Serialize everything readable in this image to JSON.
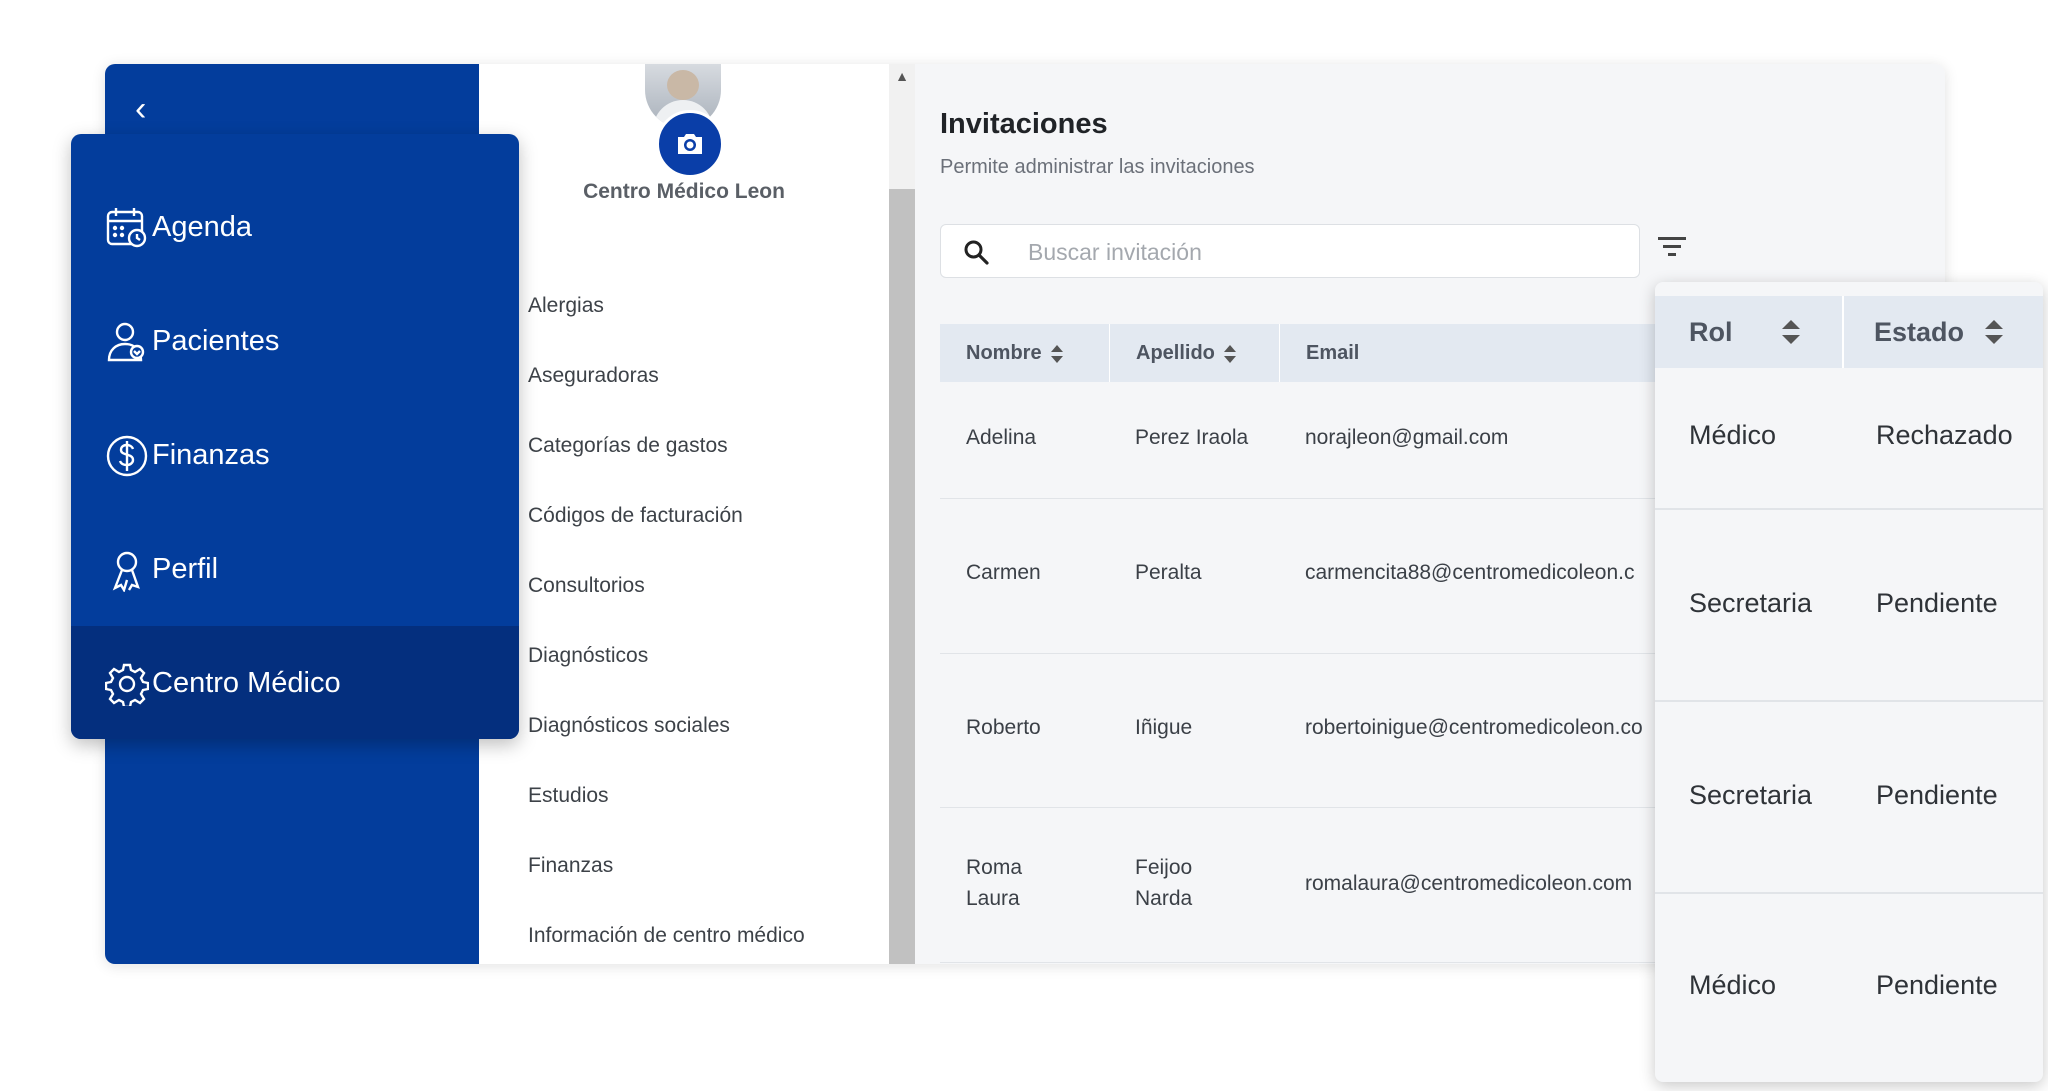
{
  "nav": {
    "items": [
      {
        "label": "Agenda",
        "icon": "calendar-icon"
      },
      {
        "label": "Pacientes",
        "icon": "patient-icon"
      },
      {
        "label": "Finanzas",
        "icon": "dollar-icon"
      },
      {
        "label": "Perfil",
        "icon": "profile-icon"
      },
      {
        "label": "Centro Médico",
        "icon": "gear-icon",
        "active": true
      }
    ]
  },
  "center": {
    "name": "Centro Médico Leon"
  },
  "settings_menu": [
    "Alergias",
    "Aseguradoras",
    "Categorías de gastos",
    "Códigos de facturación",
    "Consultorios",
    "Diagnósticos",
    "Diagnósticos sociales",
    "Estudios",
    "Finanzas",
    "Información de centro médico"
  ],
  "page": {
    "title": "Invitaciones",
    "subtitle": "Permite administrar las invitaciones",
    "search_placeholder": "Buscar invitación"
  },
  "table": {
    "headers": {
      "nombre": "Nombre",
      "apellido": "Apellido",
      "email": "Email",
      "rol": "Rol",
      "estado": "Estado"
    },
    "rows": [
      {
        "nombre": "Adelina",
        "apellido": "Perez Iraola",
        "email": "norajleon@gmail.com",
        "rol": "Médico",
        "estado": "Rechazado"
      },
      {
        "nombre": "Carmen",
        "apellido": "Peralta",
        "email": "carmencita88@centromedicoleon.c",
        "rol": "Secretaria",
        "estado": "Pendiente"
      },
      {
        "nombre": "Roberto",
        "apellido": "Iñigue",
        "email": "robertoinigue@centromedicoleon.co",
        "rol": "Secretaria",
        "estado": "Pendiente"
      },
      {
        "nombre": "Roma\nLaura",
        "apellido": "Feijoo\nNarda",
        "email": "romalaura@centromedicoleon.com",
        "rol": "Médico",
        "estado": "Pendiente"
      }
    ]
  },
  "colors": {
    "brand_blue": "#033d9c",
    "active_nav": "#042f7e",
    "table_header": "#e3e9f1"
  }
}
